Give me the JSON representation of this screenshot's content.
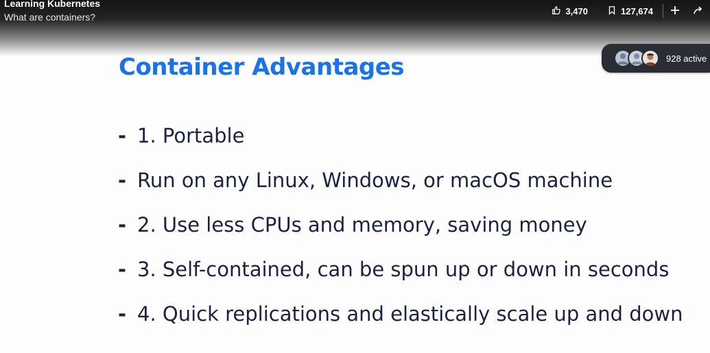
{
  "header": {
    "course_title": "Learning Kubernetes",
    "video_title": "What are containers?",
    "likes": "3,470",
    "saves": "127,674",
    "icons": [
      "like-icon",
      "bookmark-icon",
      "add-icon",
      "share-icon"
    ]
  },
  "presence": {
    "active_label": "928 active"
  },
  "slide": {
    "title": "Container Advantages",
    "bullets": [
      "1. Portable",
      "Run on any Linux, Windows, or macOS machine",
      "2. Use less CPUs and memory, saving money",
      "3. Self-contained, can be spun up or down in seconds",
      "4. Quick replications and elastically scale up and down"
    ],
    "bullet_marker": "-"
  },
  "colors": {
    "title": "#1a73e8",
    "bullet_text": "#1c2340",
    "pill_bg": "#2a2d33"
  }
}
